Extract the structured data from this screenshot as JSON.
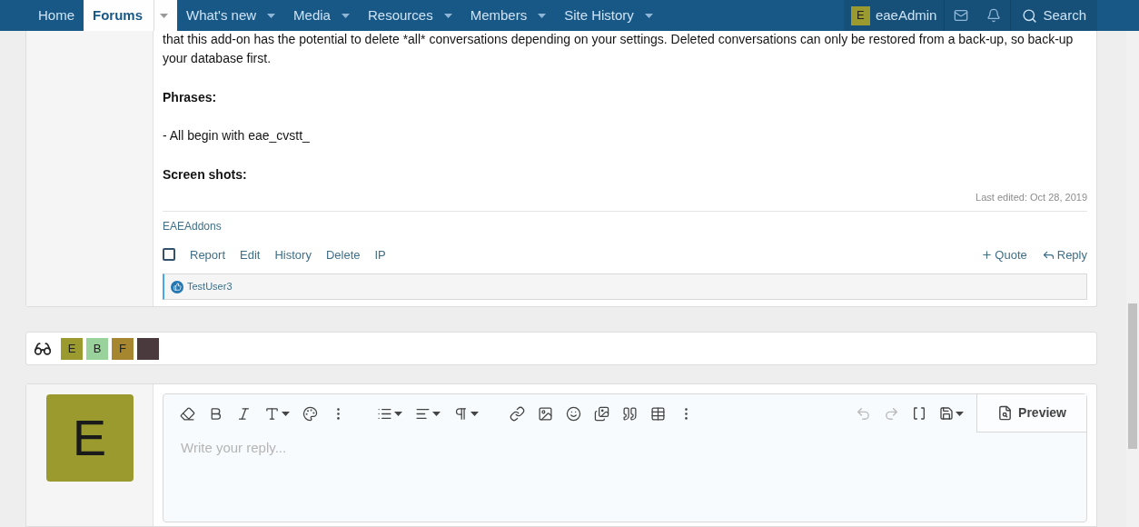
{
  "nav": {
    "items": [
      {
        "label": "Home",
        "selected": false,
        "dropdown": false
      },
      {
        "label": "Forums",
        "selected": true,
        "dropdown": true
      },
      {
        "label": "What's new",
        "selected": false,
        "dropdown": true
      },
      {
        "label": "Media",
        "selected": false,
        "dropdown": true
      },
      {
        "label": "Resources",
        "selected": false,
        "dropdown": true
      },
      {
        "label": "Members",
        "selected": false,
        "dropdown": true
      },
      {
        "label": "Site History",
        "selected": false,
        "dropdown": true
      }
    ],
    "user": {
      "initial": "E",
      "name": "eaeAdmin",
      "color": "#9a9a2e"
    },
    "search": "Search"
  },
  "post": {
    "paragraphs": [
      {
        "kind": "text",
        "text": "that this add-on has the potential to delete *all* conversations depending on your settings. Deleted conversations can only be restored from a back-up, so back-up your database first."
      },
      {
        "kind": "heading",
        "text": "Phrases:"
      },
      {
        "kind": "text",
        "text": "- All begin with eae_cvstt_"
      },
      {
        "kind": "heading",
        "text": "Screen shots:"
      }
    ],
    "last_edited": "Last edited: Oct 28, 2019",
    "signature": "EAEAddons",
    "select_checked": false,
    "actions": [
      "Report",
      "Edit",
      "History",
      "Delete",
      "IP"
    ],
    "quote": "Quote",
    "reply": "Reply",
    "reactions": "TestUser3"
  },
  "watchers": [
    {
      "kind": "letter",
      "initial": "E",
      "color": "#9a9a2e"
    },
    {
      "kind": "letter",
      "initial": "B",
      "color": "#99d29a"
    },
    {
      "kind": "letter",
      "initial": "F",
      "color": "#a6862e"
    },
    {
      "kind": "photo"
    }
  ],
  "composer": {
    "avatar": {
      "initial": "E",
      "color": "#9a9a2e"
    },
    "placeholder": "Write your reply...",
    "preview": "Preview"
  }
}
